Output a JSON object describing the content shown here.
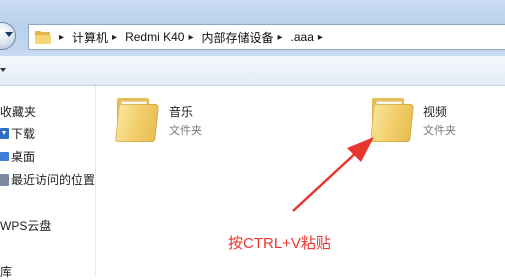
{
  "address_bar": {
    "segments": [
      "计算机",
      "Redmi K40",
      "内部存储设备",
      ".aaa"
    ],
    "separator": "▸"
  },
  "nav_pane": {
    "favorites_label": "收藏夹",
    "items": [
      {
        "label": "下载",
        "icon": "download-folder-icon"
      },
      {
        "label": "桌面",
        "icon": "desktop-icon"
      },
      {
        "label": "最近访问的位置",
        "icon": "recent-places-icon"
      }
    ],
    "wps_label": "WPS云盘",
    "library_label": "库"
  },
  "folders": [
    {
      "name": "音乐",
      "type": "文件夹",
      "icon": "folder-icon"
    },
    {
      "name": "视频",
      "type": "文件夹",
      "icon": "folder-icon"
    }
  ],
  "annotation": {
    "text": "按CTRL+V粘贴",
    "color": "#e8352e"
  }
}
